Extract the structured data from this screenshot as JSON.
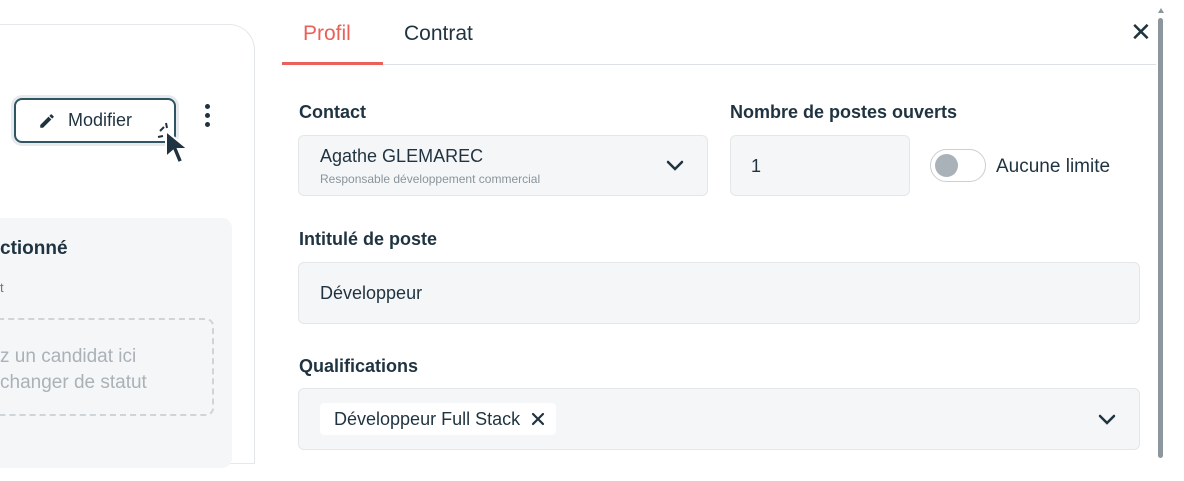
{
  "background": {
    "edit_button_label": "Modifier",
    "selected_title": "ctionné",
    "selected_sub": "t",
    "dropzone_line1": "z un candidat ici",
    "dropzone_line2": "changer de statut"
  },
  "drawer": {
    "tabs": [
      {
        "label": "Profil",
        "active": true
      },
      {
        "label": "Contrat",
        "active": false
      }
    ],
    "close_icon": "close-icon",
    "contact": {
      "label": "Contact",
      "name": "Agathe GLEMAREC",
      "role": "Responsable développement commercial"
    },
    "postes": {
      "label": "Nombre de postes ouverts",
      "value": "1",
      "toggle_label": "Aucune limite",
      "toggle_on": false
    },
    "intitule": {
      "label": "Intitulé de poste",
      "value": "Développeur"
    },
    "qualifications": {
      "label": "Qualifications",
      "chips": [
        "Développeur Full Stack"
      ]
    }
  },
  "colors": {
    "accent": "#e8615a",
    "text": "#1f3340",
    "field_bg": "#f5f6f7"
  }
}
